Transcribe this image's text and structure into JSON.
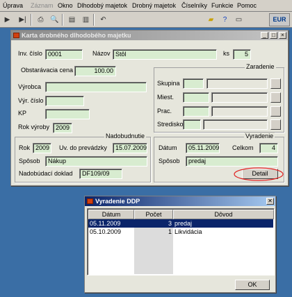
{
  "menu": {
    "items": [
      "Úprava",
      "Záznam",
      "Okno",
      "Dlhodobý majetok",
      "Drobný majetok",
      "Číselníky",
      "Funkcie",
      "Pomoc"
    ]
  },
  "toolbar": {
    "icons": [
      "play-icon",
      "last-record-icon",
      "print-icon",
      "print-preview-icon",
      "export-icon",
      "save-icon",
      "undo-icon",
      "folder-icon",
      "help-icon",
      "monitor-icon"
    ],
    "currency": "EUR"
  },
  "main_window": {
    "title": "Karta drobného dlhodobého majetku",
    "inv_label": "Inv. číslo",
    "inv_value": "0001",
    "name_label": "Názov",
    "name_value": "Stôl",
    "ks_label": "ks",
    "ks_value": "5",
    "price_label": "Obstarávacia cena",
    "price_value": "100.00",
    "vyrobca_label": "Výrobca",
    "vyrobca_value": "",
    "vyr_cislo_label": "Výr. číslo",
    "vyr_cislo_value": "",
    "kp_label": "KP",
    "kp_value": "",
    "rok_vyroby_label": "Rok výroby",
    "rok_vyroby_value": "2009",
    "zaradenie": {
      "title": "Zaradenie",
      "rows": [
        {
          "label": "Skupina"
        },
        {
          "label": "Miest."
        },
        {
          "label": "Prac."
        },
        {
          "label": "Stredisko"
        }
      ]
    },
    "nadobudnutie": {
      "title": "Nadobudnutie",
      "rok_label": "Rok",
      "rok_value": "2009",
      "uv_label": "Uv. do prevádzky",
      "uv_value": "15.07.2009",
      "sposob_label": "Spôsob",
      "sposob_value": "Nákup",
      "doklad_label": "Nadobúdací doklad",
      "doklad_value": "DF109/09"
    },
    "vyradenie": {
      "title": "Vyradenie",
      "datum_label": "Dátum",
      "datum_value": "05.11.2009",
      "celkom_label": "Celkom",
      "celkom_value": "4",
      "sposob_label": "Spôsob",
      "sposob_value": "predaj",
      "detail_label": "Detail"
    },
    "annotation_color": "#e02020"
  },
  "dialog": {
    "title": "Vyradenie DDP",
    "columns": [
      "Dátum",
      "Počet",
      "Dôvod"
    ],
    "rows": [
      {
        "datum": "05.11.2009",
        "pocet": "3",
        "dovod": "predaj"
      },
      {
        "datum": "05.10.2009",
        "pocet": "1",
        "dovod": "Likvidácia"
      }
    ],
    "ok_label": "OK",
    "close_glyph": "✕"
  },
  "colors": {
    "desktop": "#3a6ea5",
    "field_bg": "#d8ecd0",
    "selection": "#0a246a"
  }
}
